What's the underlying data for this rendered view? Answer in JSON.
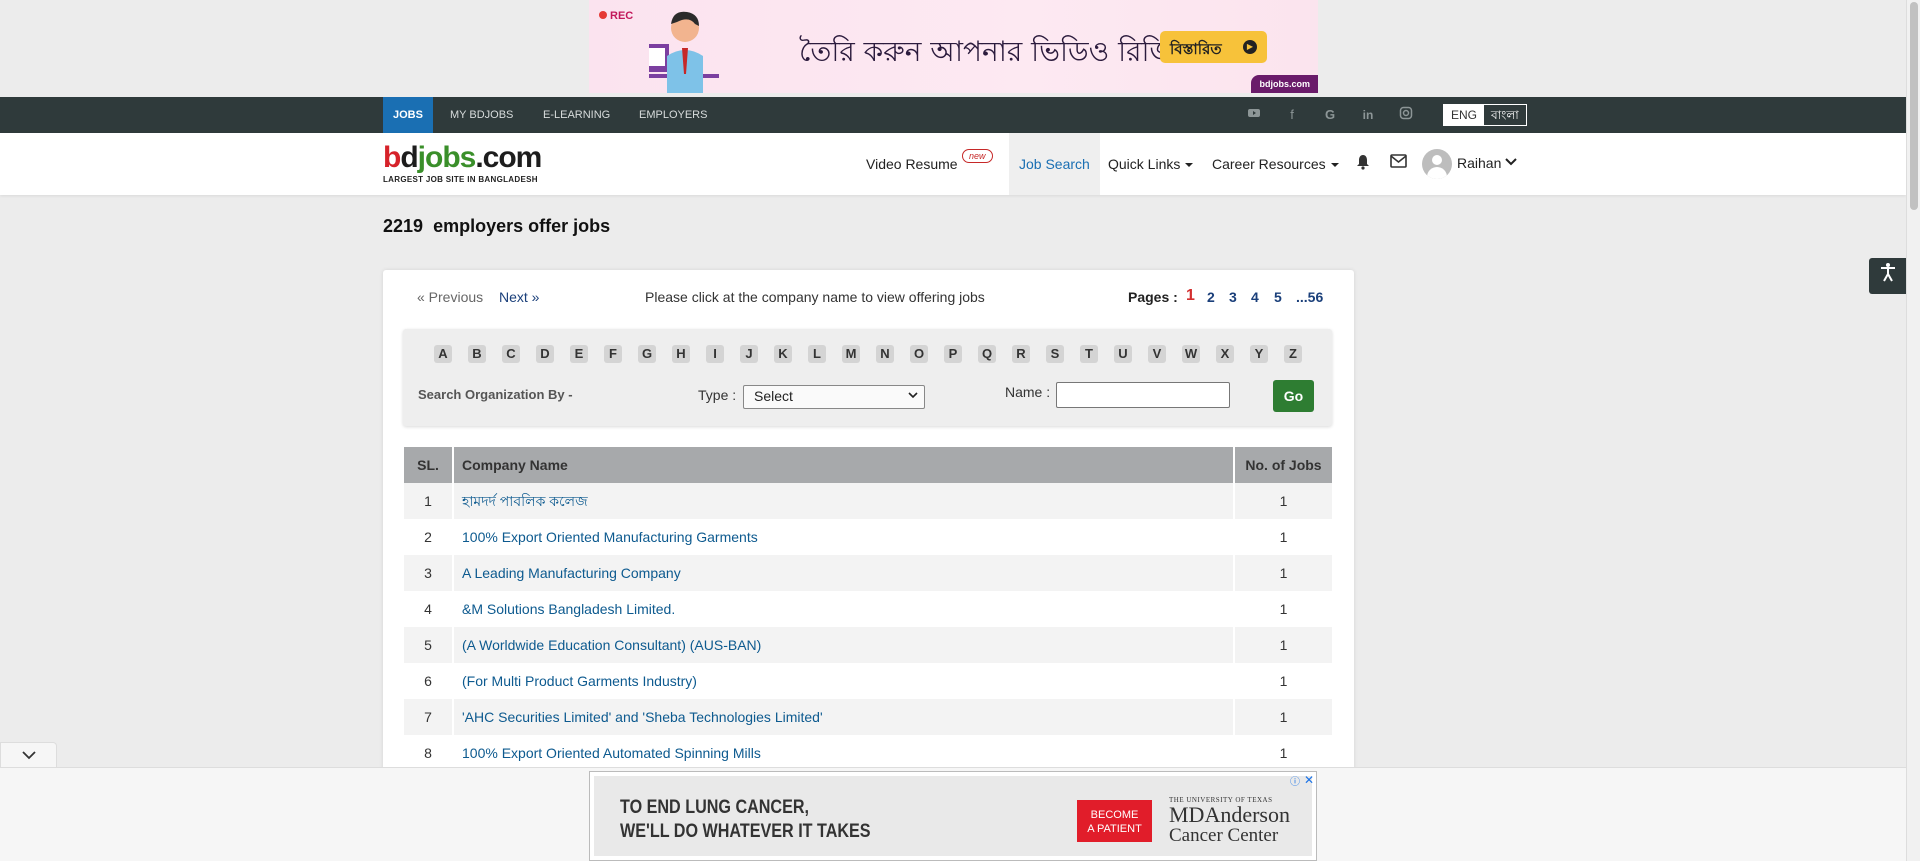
{
  "top_ad": {
    "rec": "REC",
    "headline": "তৈরি করুন আপনার ভিডিও রিজিউমি",
    "button": "বিস্তারিত",
    "brand": "bdjobs.com"
  },
  "topnav": {
    "items": [
      "JOBS",
      "MY BDJOBS",
      "E-LEARNING",
      "EMPLOYERS"
    ],
    "social_icons": [
      "youtube-icon",
      "facebook-icon",
      "google-icon",
      "linkedin-icon",
      "instagram-icon"
    ],
    "lang_eng": "ENG",
    "lang_ban": "বাংলা"
  },
  "header": {
    "logo": "bdjobs.com",
    "tagline": "LARGEST JOB SITE IN BANGLADESH",
    "video_resume": "Video Resume",
    "new_badge": "new",
    "job_search": "Job Search",
    "quick_links": "Quick Links",
    "career_resources": "Career Resources",
    "user_name": "Raihan"
  },
  "page": {
    "count": "2219",
    "title_suffix": "employers offer jobs"
  },
  "pager": {
    "prev": "« Previous",
    "next": "Next »",
    "message": "Please click at the company name to view offering jobs",
    "pages_label": "Pages :",
    "pages": [
      "1",
      "2",
      "3",
      "4",
      "5",
      "...56"
    ],
    "current": "1"
  },
  "filter": {
    "letters": [
      "A",
      "B",
      "C",
      "D",
      "E",
      "F",
      "G",
      "H",
      "I",
      "J",
      "K",
      "L",
      "M",
      "N",
      "O",
      "P",
      "Q",
      "R",
      "S",
      "T",
      "U",
      "V",
      "W",
      "X",
      "Y",
      "Z"
    ],
    "search_by": "Search Organization By -",
    "type_label": "Type :",
    "type_value": "Select",
    "name_label": "Name :",
    "name_value": "",
    "go": "Go"
  },
  "table": {
    "headers": [
      "SL.",
      "Company Name",
      "No. of Jobs"
    ],
    "rows": [
      {
        "sl": "1",
        "name": "হামদর্দ পাবলিক কলেজ",
        "jobs": "1"
      },
      {
        "sl": "2",
        "name": "100% Export Oriented Manufacturing Garments",
        "jobs": "1"
      },
      {
        "sl": "3",
        "name": "A Leading Manufacturing Company",
        "jobs": "1"
      },
      {
        "sl": "4",
        "name": "&M Solutions Bangladesh Limited.",
        "jobs": "1"
      },
      {
        "sl": "5",
        "name": "(A Worldwide Education Consultant) (AUS-BAN)",
        "jobs": "1"
      },
      {
        "sl": "6",
        "name": "(For Multi Product Garments Industry)",
        "jobs": "1"
      },
      {
        "sl": "7",
        "name": "'AHC Securities Limited' and 'Sheba Technologies Limited'",
        "jobs": "1"
      },
      {
        "sl": "8",
        "name": "100% Export Oriented Automated Spinning Mills",
        "jobs": "1"
      }
    ]
  },
  "bottom_ad": {
    "line1": "TO END LUNG CANCER,",
    "line2": "WE'LL DO WHATEVER IT TAKES",
    "cta_line1": "BECOME",
    "cta_line2": "A PATIENT",
    "univ": "THE UNIVERSITY OF TEXAS",
    "org1": "MDAnderson",
    "org2": "Cancer Center"
  },
  "colors": {
    "nav_bg": "#2f3a3b",
    "nav_active": "#1a6fb3",
    "link": "#0d5a8f",
    "go_button": "#2e7d32",
    "current_page": "#d32f2f"
  }
}
